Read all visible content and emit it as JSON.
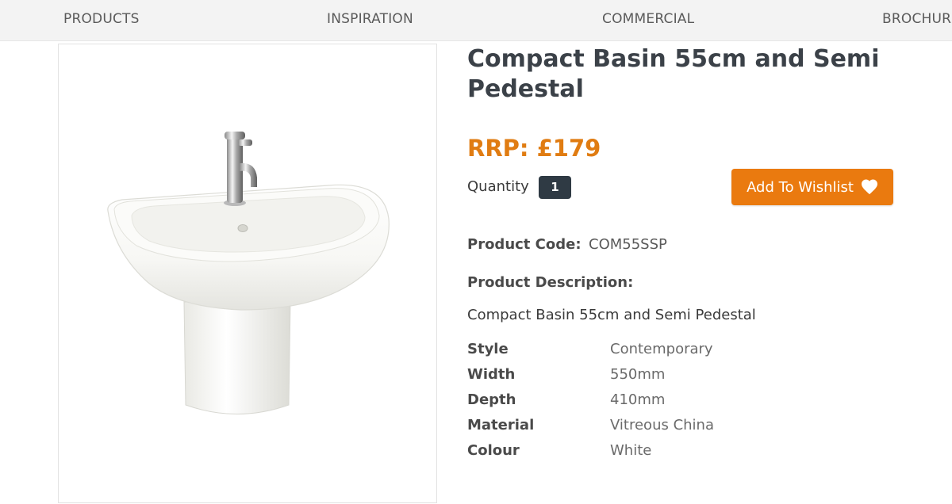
{
  "nav": {
    "items": [
      {
        "label": "PRODUCTS"
      },
      {
        "label": "INSPIRATION"
      },
      {
        "label": "COMMERCIAL"
      },
      {
        "label": "BROCHURES"
      }
    ]
  },
  "product": {
    "title": "Compact Basin 55cm and Semi Pedestal",
    "price": "RRP: £179",
    "quantity_label": "Quantity",
    "quantity_value": "1",
    "wishlist_label": "Add To Wishlist",
    "wishlist_icon": "heart-icon",
    "code_label": "Product Code:",
    "code_value": "COM55SSP",
    "description_label": "Product Description:",
    "description_text": "Compact Basin 55cm and Semi Pedestal",
    "specs": [
      {
        "key": "Style",
        "value": "Contemporary"
      },
      {
        "key": "Width",
        "value": "550mm"
      },
      {
        "key": "Depth",
        "value": "410mm"
      },
      {
        "key": "Material",
        "value": "Vitreous China"
      },
      {
        "key": "Colour",
        "value": "White"
      }
    ],
    "image_subject": "basin-with-semi-pedestal-image"
  },
  "colors": {
    "accent_orange": "#ea7a0f",
    "price_orange": "#e07c12",
    "dark_slate": "#2f3a44",
    "nav_bg": "#f3f3f3"
  }
}
